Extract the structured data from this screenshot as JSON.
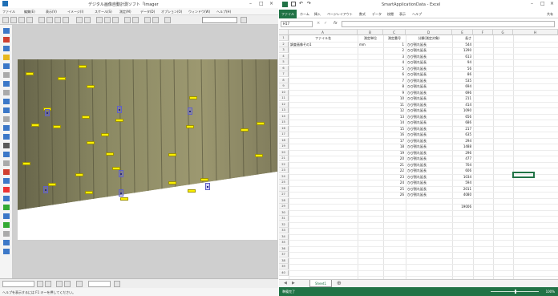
{
  "left_app": {
    "title": "デジタル画像自動計測ソフト「Imager",
    "menu": [
      "ファイル",
      "編集(E)",
      "表示(V)",
      "イメージ(I)",
      "スケール(S)",
      "測定(M)",
      "データ(D)",
      "オプション(O)",
      "ウィンドウ(W)",
      "ヘルプ(H)"
    ],
    "status_text": "ヘルプを表示するには F1 キーを押してください。",
    "crack_labels": [
      "",
      "",
      "",
      "",
      "",
      "",
      "",
      "",
      "",
      "",
      "",
      "",
      "",
      "",
      "",
      "",
      "",
      "",
      "",
      "",
      "",
      "",
      "",
      "",
      "",
      "",
      ""
    ]
  },
  "excel": {
    "title": "SmartApplicationData - Excel",
    "file_tab": "ファイル",
    "tabs": [
      "ホーム",
      "挿入",
      "ページレイアウト",
      "数式",
      "データ",
      "校閲",
      "表示",
      "ヘルプ"
    ],
    "share": "共有",
    "name_box": "H17",
    "fx": "fx",
    "columns": [
      "A",
      "B",
      "C",
      "D",
      "E",
      "F",
      "G",
      "H"
    ],
    "header_row": [
      "ファイル名",
      "測定単位",
      "測定番号",
      "分類(測定対象)",
      "長さ"
    ],
    "row2": [
      "調査画像その1",
      "mm",
      "1",
      "ひび割れ延長",
      "544"
    ],
    "data_rows": [
      {
        "no": "2",
        "type": "ひび割れ延長",
        "len": "1290"
      },
      {
        "no": "3",
        "type": "ひび割れ延長",
        "len": "613"
      },
      {
        "no": "4",
        "type": "ひび割れ延長",
        "len": "94"
      },
      {
        "no": "5",
        "type": "ひび割れ延長",
        "len": "56"
      },
      {
        "no": "6",
        "type": "ひび割れ延長",
        "len": "86"
      },
      {
        "no": "7",
        "type": "ひび割れ延長",
        "len": "535"
      },
      {
        "no": "8",
        "type": "ひび割れ延長",
        "len": "694"
      },
      {
        "no": "9",
        "type": "ひび割れ延長",
        "len": "696"
      },
      {
        "no": "10",
        "type": "ひび割れ延長",
        "len": "211"
      },
      {
        "no": "11",
        "type": "ひび割れ延長",
        "len": "414"
      },
      {
        "no": "12",
        "type": "ひび割れ延長",
        "len": "1090"
      },
      {
        "no": "13",
        "type": "ひび割れ延長",
        "len": "656"
      },
      {
        "no": "14",
        "type": "ひび割れ延長",
        "len": "686"
      },
      {
        "no": "15",
        "type": "ひび割れ延長",
        "len": "217"
      },
      {
        "no": "16",
        "type": "ひび割れ延長",
        "len": "635"
      },
      {
        "no": "17",
        "type": "ひび割れ延長",
        "len": "294"
      },
      {
        "no": "18",
        "type": "ひび割れ延長",
        "len": "1488"
      },
      {
        "no": "19",
        "type": "ひび割れ延長",
        "len": "296"
      },
      {
        "no": "20",
        "type": "ひび割れ延長",
        "len": "477"
      },
      {
        "no": "21",
        "type": "ひび割れ延長",
        "len": "704"
      },
      {
        "no": "22",
        "type": "ひび割れ延長",
        "len": "606"
      },
      {
        "no": "23",
        "type": "ひび割れ延長",
        "len": "1034"
      },
      {
        "no": "24",
        "type": "ひび割れ延長",
        "len": "594"
      },
      {
        "no": "25",
        "type": "ひび割れ延長",
        "len": "2011"
      },
      {
        "no": "26",
        "type": "ひび割れ延長",
        "len": "4080"
      }
    ],
    "total": "19006",
    "sheet_tab": "Sheet1",
    "status": "準備完了",
    "zoom": "100%"
  }
}
